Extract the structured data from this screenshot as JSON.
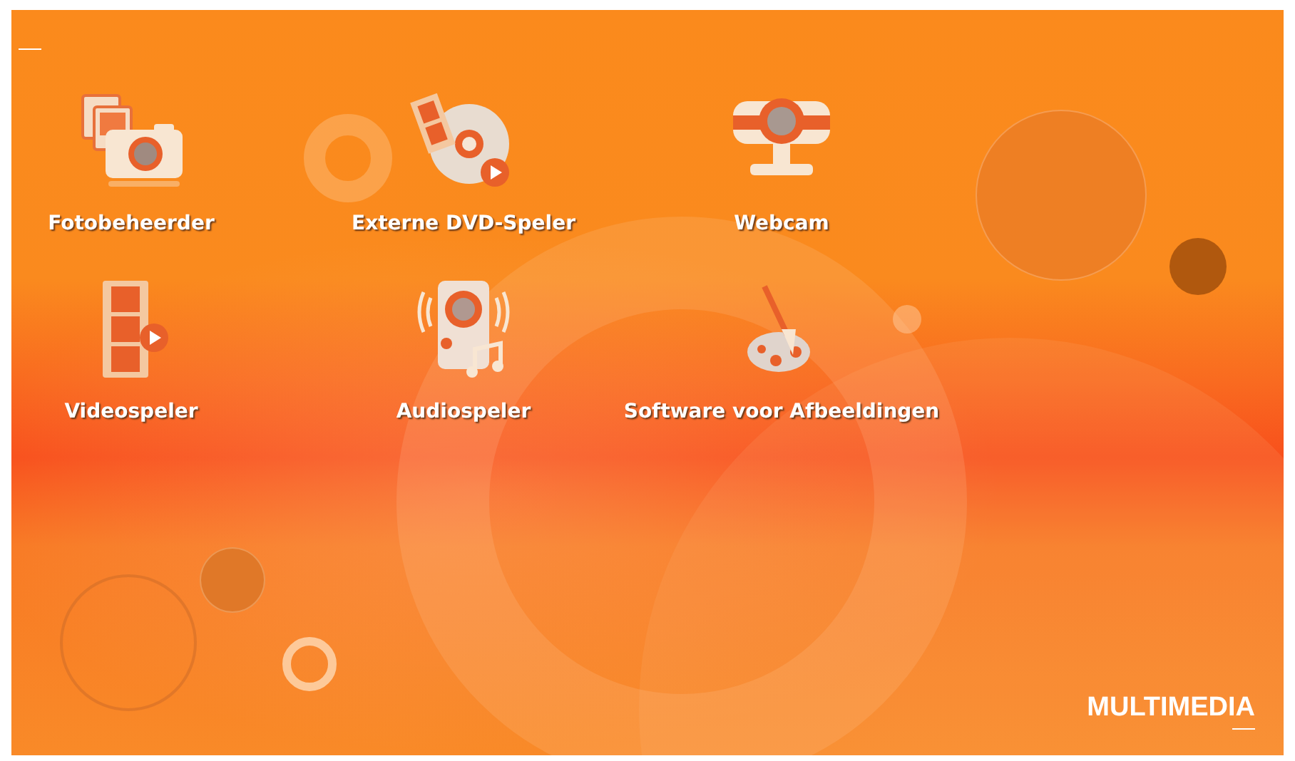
{
  "launchers": [
    {
      "label": "Fotobeheerder",
      "kind": "photos"
    },
    {
      "label": "Externe DVD-Speler",
      "kind": "dvd"
    },
    {
      "label": "Webcam",
      "kind": "webcam"
    },
    {
      "label": "Videospeler",
      "kind": "video"
    },
    {
      "label": "Audiospeler",
      "kind": "audio"
    },
    {
      "label": "Software voor Afbeeldingen",
      "kind": "paint"
    }
  ],
  "brand": "MULTIMEDIA"
}
